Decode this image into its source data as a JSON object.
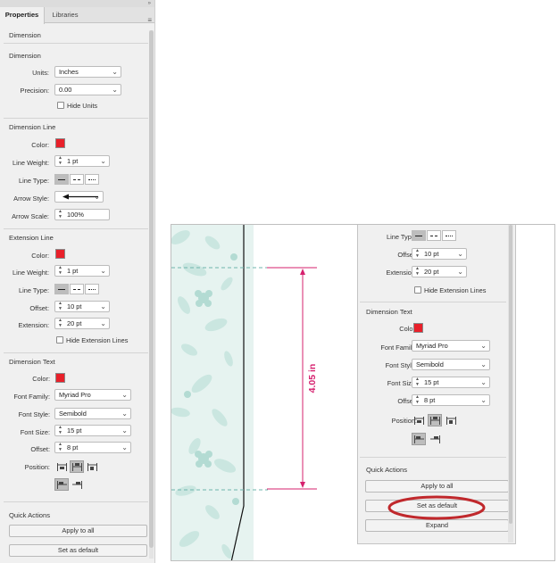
{
  "tabs": [
    {
      "label": "Properties",
      "active": true
    },
    {
      "label": "Libraries",
      "active": false
    }
  ],
  "panel_header": "Dimension",
  "dimension": {
    "title": "Dimension",
    "units_label": "Units:",
    "units_value": "Inches",
    "precision_label": "Precision:",
    "precision_value": "0.00",
    "hide_units_label": "Hide Units",
    "hide_units_checked": false
  },
  "dimension_line": {
    "title": "Dimension Line",
    "color_label": "Color:",
    "color": "#e8202a",
    "line_weight_label": "Line Weight:",
    "line_weight_value": "1 pt",
    "line_type_label": "Line Type:",
    "arrow_style_label": "Arrow Style:",
    "arrow_scale_label": "Arrow Scale:",
    "arrow_scale_value": "100%"
  },
  "extension_line": {
    "title": "Extension Line",
    "color_label": "Color:",
    "line_weight_label": "Line Weight:",
    "line_weight_value": "1 pt",
    "line_type_label": "Line Type:",
    "offset_label": "Offset:",
    "offset_value": "10 pt",
    "extension_label": "Extension:",
    "extension_value": "20 pt",
    "hide_extension_label": "Hide Extension Lines",
    "hide_extension_checked": false
  },
  "dimension_text": {
    "title": "Dimension Text",
    "color_label": "Color:",
    "font_family_label": "Font Family:",
    "font_family_value": "Myriad Pro",
    "font_style_label": "Font Style:",
    "font_style_value": "Semibold",
    "font_size_label": "Font Size:",
    "font_size_value": "15 pt",
    "offset_label": "Offset:",
    "offset_value": "8 pt",
    "position_label": "Position:"
  },
  "quick_actions": {
    "title": "Quick Actions",
    "apply_to_all": "Apply to all",
    "set_as_default": "Set as default",
    "expand": "Expand"
  },
  "canvas": {
    "dimension_text": "4.05 in",
    "dimension_color": "#d6206e",
    "highlight_color": "#c0282c"
  },
  "colors": {
    "accent_red": "#e8202a",
    "panel_bg": "#f0f0f0",
    "pattern_bg": "#e6f3f0",
    "pattern_leaf": "#bfe0da"
  }
}
